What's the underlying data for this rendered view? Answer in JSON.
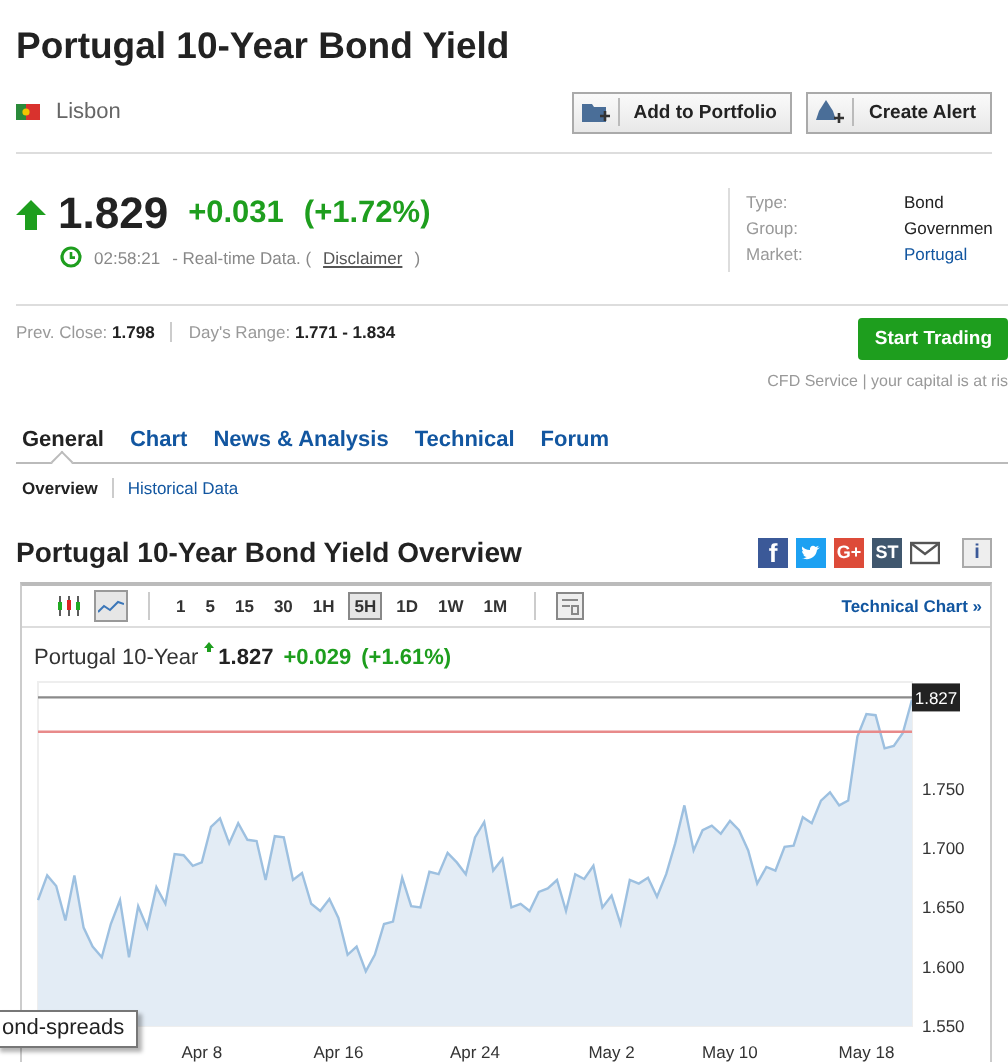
{
  "page": {
    "title": "Portugal 10-Year Bond Yield",
    "location": "Lisbon",
    "buttons": [
      {
        "label": "Add to Portfolio",
        "kind": "portfolio"
      },
      {
        "label": "Create Alert",
        "kind": "alert"
      }
    ]
  },
  "quote": {
    "last": "1.829",
    "change": "+0.031",
    "change_pct": "(+1.72%)",
    "time": "02:58:21",
    "time_note": "- Real-time Data. (",
    "disclaimer": "Disclaimer",
    "time_close": ")"
  },
  "info": [
    {
      "label": "Type:",
      "value": "Bond",
      "link": false
    },
    {
      "label": "Group:",
      "value": "Governmen",
      "link": false
    },
    {
      "label": "Market:",
      "value": "Portugal",
      "link": true
    }
  ],
  "stats": [
    {
      "label": "Prev. Close:",
      "value": "1.798"
    },
    {
      "label": "Day's Range:",
      "value": "1.771 - 1.834"
    }
  ],
  "trade": {
    "button": "Start Trading",
    "note": "CFD Service | your capital is at ris"
  },
  "tabs": [
    {
      "label": "General",
      "selected": true
    },
    {
      "label": "Chart",
      "selected": false
    },
    {
      "label": "News & Analysis",
      "selected": false
    },
    {
      "label": "Technical",
      "selected": false
    },
    {
      "label": "Forum",
      "selected": false
    }
  ],
  "subtabs": [
    {
      "label": "Overview",
      "selected": true
    },
    {
      "label": "Historical Data",
      "selected": false
    }
  ],
  "overview": {
    "title": "Portugal 10-Year Bond Yield Overview",
    "share": [
      {
        "kind": "facebook",
        "text": "f"
      },
      {
        "kind": "twitter"
      },
      {
        "kind": "googleplus",
        "text": "G+"
      },
      {
        "kind": "stocktwits",
        "text": "ST"
      },
      {
        "kind": "email"
      },
      {
        "kind": "info",
        "text": "i"
      }
    ]
  },
  "chart": {
    "types": [
      {
        "kind": "candles",
        "selected": false
      },
      {
        "kind": "line",
        "selected": true
      }
    ],
    "intervals": [
      {
        "label": "1",
        "selected": false
      },
      {
        "label": "5",
        "selected": false
      },
      {
        "label": "15",
        "selected": false
      },
      {
        "label": "30",
        "selected": false
      },
      {
        "label": "1H",
        "selected": false
      },
      {
        "label": "5H",
        "selected": true
      },
      {
        "label": "1D",
        "selected": false
      },
      {
        "label": "1W",
        "selected": false
      },
      {
        "label": "1M",
        "selected": false
      }
    ],
    "technical_link": "Technical Chart",
    "link_arrow": "»",
    "last": "1.827",
    "change": "+0.029",
    "change_pct": "(+1.61%)",
    "chart_data": {
      "type": "area",
      "ylim": [
        1.55,
        1.84
      ],
      "yticks": [
        {
          "value": 1.55,
          "label": "1.550"
        },
        {
          "value": 1.6,
          "label": "1.600"
        },
        {
          "value": 1.65,
          "label": "1.650"
        },
        {
          "value": 1.7,
          "label": "1.700"
        },
        {
          "value": 1.75,
          "label": "1.750"
        }
      ],
      "categories": [
        null,
        null,
        null,
        null,
        null,
        null,
        null,
        null,
        null,
        null,
        null,
        null,
        null,
        null,
        null,
        null,
        null,
        null,
        "Apr 8",
        null,
        null,
        null,
        null,
        null,
        null,
        null,
        null,
        null,
        null,
        null,
        null,
        null,
        null,
        "Apr 16",
        null,
        null,
        null,
        null,
        null,
        null,
        null,
        null,
        null,
        null,
        null,
        null,
        null,
        null,
        "Apr 24",
        null,
        null,
        null,
        null,
        null,
        null,
        null,
        null,
        null,
        null,
        null,
        null,
        null,
        null,
        "May 2",
        null,
        null,
        null,
        null,
        null,
        null,
        null,
        null,
        null,
        null,
        null,
        null,
        "May 10",
        null,
        null,
        null,
        null,
        null,
        null,
        null,
        null,
        null,
        null,
        null,
        null,
        null,
        null,
        "May 18",
        null,
        null,
        null,
        null,
        null
      ],
      "series": [
        {
          "name": "Portugal 10-Year",
          "color": "#9dc0e0",
          "values": [
            1.656,
            1.677,
            1.668,
            1.639,
            1.677,
            1.633,
            1.617,
            1.608,
            1.636,
            1.656,
            1.608,
            1.651,
            1.633,
            1.667,
            1.653,
            1.695,
            1.694,
            1.685,
            1.688,
            1.718,
            1.725,
            1.704,
            1.721,
            1.707,
            1.706,
            1.673,
            1.71,
            1.709,
            1.673,
            1.679,
            1.653,
            1.647,
            1.657,
            1.641,
            1.61,
            1.617,
            1.596,
            1.61,
            1.636,
            1.638,
            1.675,
            1.651,
            1.65,
            1.68,
            1.678,
            1.696,
            1.688,
            1.678,
            1.709,
            1.722,
            1.681,
            1.691,
            1.65,
            1.653,
            1.647,
            1.663,
            1.666,
            1.673,
            1.647,
            1.678,
            1.674,
            1.685,
            1.65,
            1.66,
            1.636,
            1.673,
            1.67,
            1.675,
            1.659,
            1.678,
            1.704,
            1.736,
            1.698,
            1.715,
            1.719,
            1.712,
            1.723,
            1.715,
            1.698,
            1.67,
            1.684,
            1.681,
            1.701,
            1.702,
            1.726,
            1.721,
            1.74,
            1.747,
            1.736,
            1.74,
            1.794,
            1.813,
            1.812,
            1.784,
            1.786,
            1.797,
            1.825
          ]
        }
      ],
      "ref_lines": [
        {
          "axis": "y",
          "value": 1.827,
          "label": "1.827",
          "color": "#8a8a8a"
        },
        {
          "axis": "y",
          "value": 1.798,
          "color": "#e88a8a"
        }
      ]
    }
  },
  "tooltip": "ond-spreads"
}
